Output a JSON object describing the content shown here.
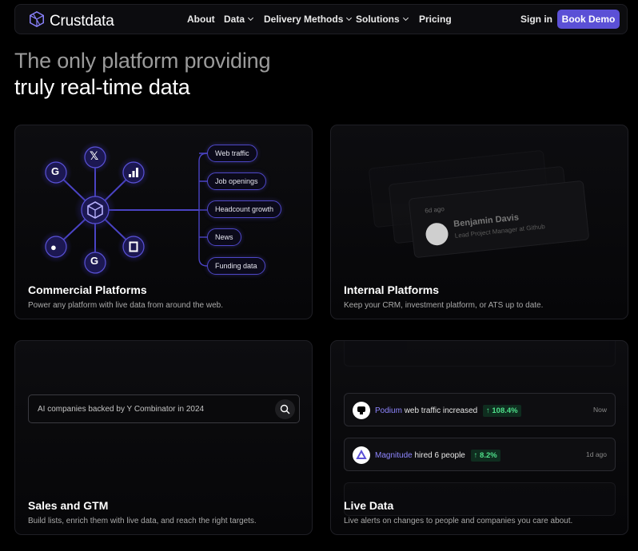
{
  "nav": {
    "brand": "Crustdata",
    "links": [
      "About",
      "Data",
      "Delivery Methods",
      "Solutions",
      "Pricing"
    ],
    "signin": "Sign in",
    "cta": "Book Demo"
  },
  "hero": {
    "line1": "The only platform providing",
    "line2": "truly real-time data"
  },
  "cards": {
    "commercial": {
      "title": "Commercial Platforms",
      "desc": "Power any platform with live data from around the web.",
      "pills": [
        "Web traffic",
        "Job openings",
        "Headcount growth",
        "News",
        "Funding data"
      ]
    },
    "internal": {
      "title": "Internal Platforms",
      "desc": "Keep your CRM, investment platform, or ATS up to date.",
      "profile_time": "6d ago",
      "profile_name": "Benjamin Davis",
      "profile_role": "Lead Project Manager at Github"
    },
    "sales": {
      "title": "Sales and GTM",
      "desc": "Build lists, enrich them with live data, and reach the right targets.",
      "search_text": "AI companies backed by Y Combinator in 2024"
    },
    "live": {
      "title": "Live Data",
      "desc": "Live alerts on changes to people and companies you care about.",
      "alerts": [
        {
          "company": "Podium",
          "text": "web traffic increased",
          "badge": "↑ 108.4%",
          "time": "Now"
        },
        {
          "company": "Magnitude",
          "text": "hired 6 people",
          "badge": "↑ 8.2%",
          "time": "1d ago"
        }
      ]
    }
  },
  "colors": {
    "accent": "#5b50d6",
    "positive": "#4ee08a",
    "company_link": "#8e86ff"
  }
}
